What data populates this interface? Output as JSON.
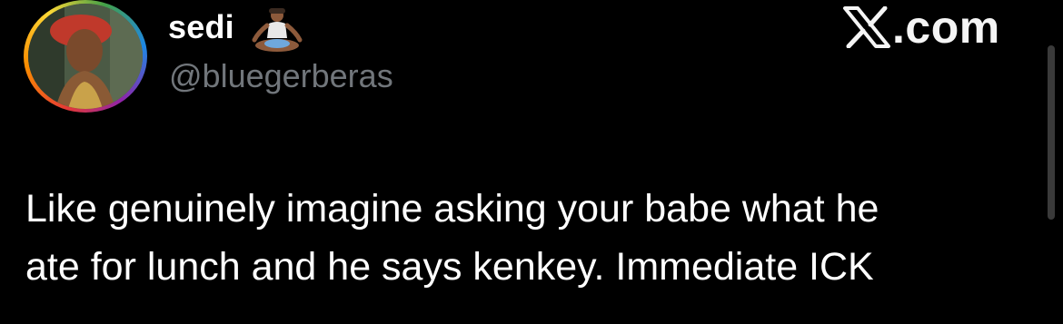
{
  "brand": {
    "logo_text": ".com",
    "logo_icon": "x-logo-icon"
  },
  "author": {
    "display_name": "sedi",
    "name_emoji": "person-in-lotus-position-emoji",
    "handle": "@bluegerberas",
    "avatar_ring_colors": [
      "#e53935",
      "#fb8c00",
      "#fdd835",
      "#43a047",
      "#1e88e5",
      "#8e24aa"
    ]
  },
  "tweet": {
    "lines": [
      "Like genuinely imagine asking your babe what he",
      "ate for lunch and he says kenkey. Immediate ICK"
    ]
  },
  "colors": {
    "background": "#000000",
    "text_primary": "#ffffff",
    "text_secondary": "#71767b"
  }
}
